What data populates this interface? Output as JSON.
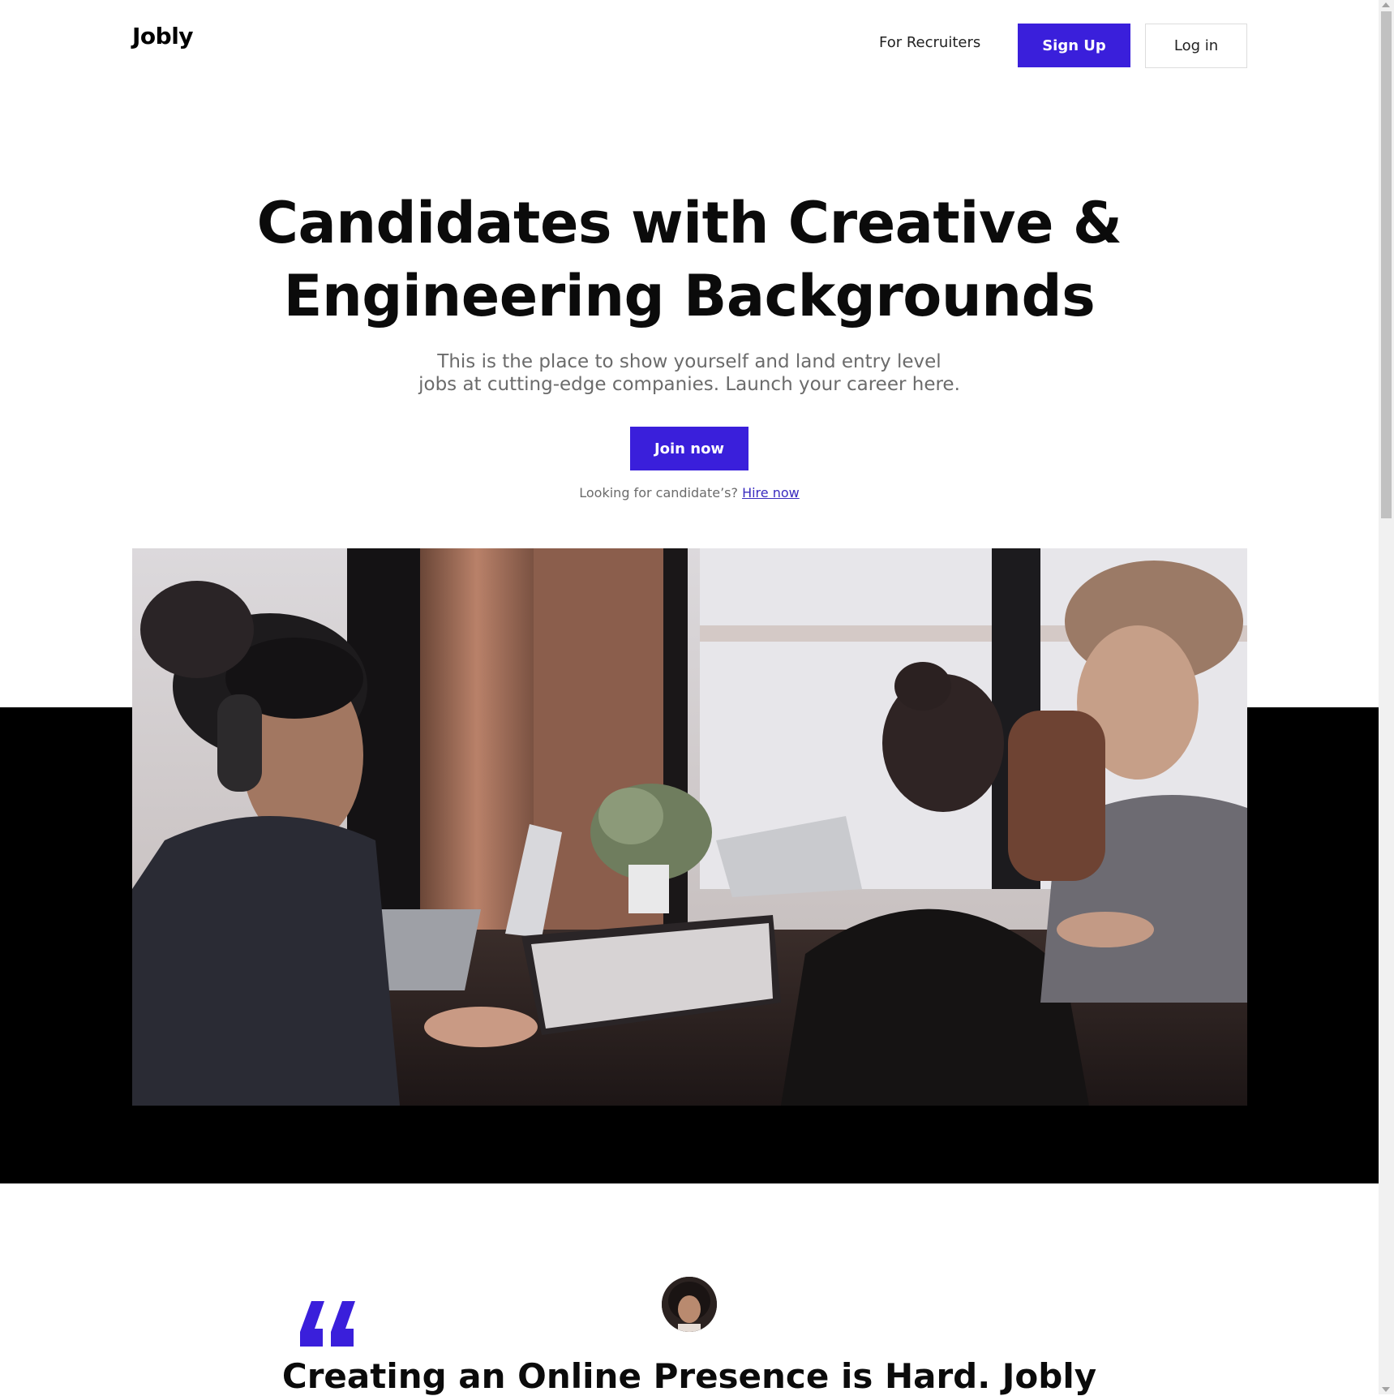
{
  "header": {
    "brand": "Jobly",
    "nav_recruiters": "For Recruiters",
    "signup_label": "Sign Up",
    "login_label": "Log in"
  },
  "hero": {
    "title_line1": "Candidates with Creative &",
    "title_line2": "Engineering Backgrounds",
    "subtitle_line1": "This is the place to show yourself and land entry level",
    "subtitle_line2": "jobs at cutting-edge companies. Launch your career here.",
    "join_label": "Join now",
    "hire_prompt": "Looking for candidate’s?",
    "hire_link": "Hire now"
  },
  "testimonial": {
    "quote_icon": "quote-icon",
    "title": "Creating an Online Presence is Hard. Jobly"
  },
  "colors": {
    "accent": "#3a1fdb",
    "text_dark": "#0b0b0b",
    "text_muted": "#6b6b6b",
    "band": "#000000"
  }
}
